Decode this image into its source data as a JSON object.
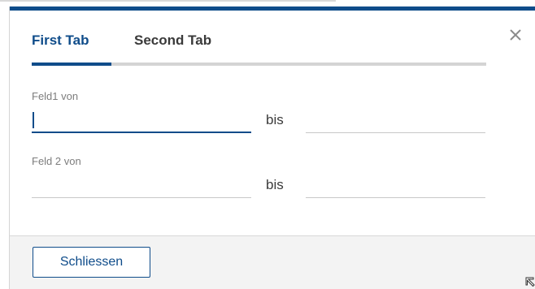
{
  "tabs": [
    {
      "label": "First Tab",
      "active": true
    },
    {
      "label": "Second Tab",
      "active": false
    }
  ],
  "fields": [
    {
      "label": "Feld1 von",
      "from_value": "",
      "to_value": "",
      "separator": "bis"
    },
    {
      "label": "Feld 2 von",
      "from_value": "",
      "to_value": "",
      "separator": "bis"
    }
  ],
  "footer": {
    "close_label": "Schliessen"
  },
  "icons": {
    "close": "close-icon",
    "resize": "resize-grip-icon"
  },
  "colors": {
    "accent": "#0f4c8a",
    "tab_track": "#d4d4d4",
    "label": "#7d7d7d"
  }
}
